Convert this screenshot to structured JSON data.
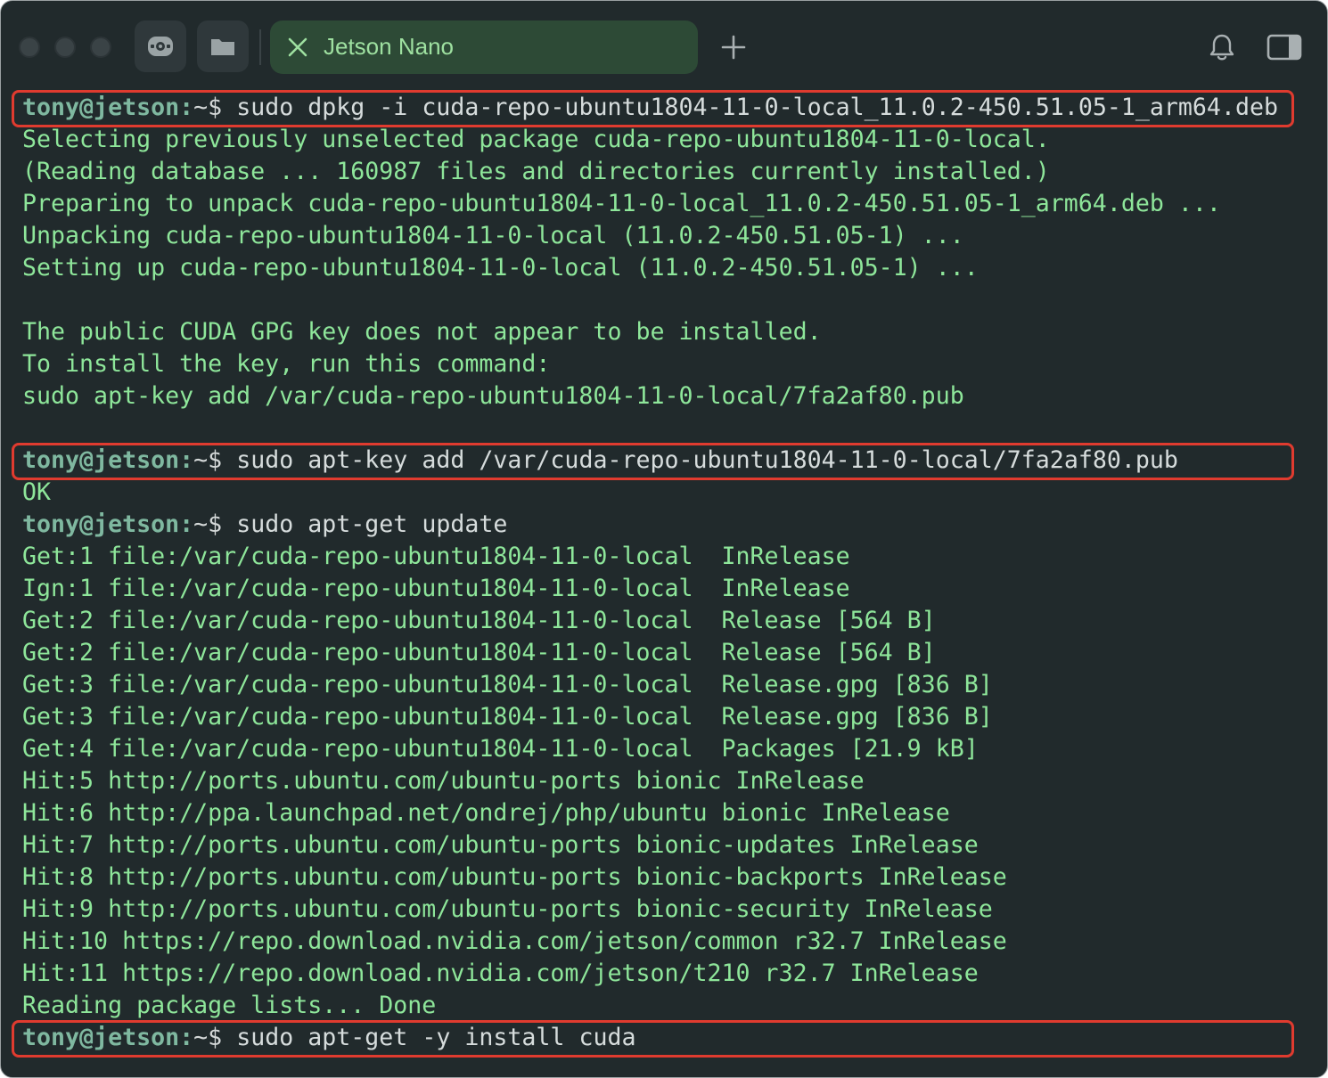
{
  "tab": {
    "title": "Jetson Nano"
  },
  "icons": {
    "tab_close": "close-x-icon",
    "new_tab": "plus-icon",
    "notifications": "bell-icon",
    "sidebar": "sidebar-toggle-icon",
    "tool_1": "steering-wheel-icon",
    "tool_2": "folder-icon"
  },
  "colors": {
    "background": "#212a2c",
    "output_text": "#8ee69a",
    "prompt_user": "#7fb8a0",
    "command_text": "#d6dcdc",
    "highlight_border": "#e03b2f",
    "tab_background": "#2d4a36",
    "tab_text": "#9ee0a0"
  },
  "terminal": {
    "prompt_user": "tony@jetson:",
    "prompt_path": "~$ ",
    "lines": [
      {
        "type": "command",
        "text": "sudo dpkg -i cuda-repo-ubuntu1804-11-0-local_11.0.2-450.51.05-1_arm64.deb",
        "highlighted": true
      },
      {
        "type": "output",
        "text": "Selecting previously unselected package cuda-repo-ubuntu1804-11-0-local."
      },
      {
        "type": "output",
        "text": "(Reading database ... 160987 files and directories currently installed.)"
      },
      {
        "type": "output",
        "text": "Preparing to unpack cuda-repo-ubuntu1804-11-0-local_11.0.2-450.51.05-1_arm64.deb ..."
      },
      {
        "type": "output",
        "text": "Unpacking cuda-repo-ubuntu1804-11-0-local (11.0.2-450.51.05-1) ..."
      },
      {
        "type": "output",
        "text": "Setting up cuda-repo-ubuntu1804-11-0-local (11.0.2-450.51.05-1) ..."
      },
      {
        "type": "output",
        "text": ""
      },
      {
        "type": "output",
        "text": "The public CUDA GPG key does not appear to be installed."
      },
      {
        "type": "output",
        "text": "To install the key, run this command:"
      },
      {
        "type": "output",
        "text": "sudo apt-key add /var/cuda-repo-ubuntu1804-11-0-local/7fa2af80.pub"
      },
      {
        "type": "output",
        "text": ""
      },
      {
        "type": "command",
        "text": "sudo apt-key add /var/cuda-repo-ubuntu1804-11-0-local/7fa2af80.pub",
        "highlighted": true
      },
      {
        "type": "output",
        "text": "OK"
      },
      {
        "type": "command",
        "text": "sudo apt-get update",
        "highlighted": false
      },
      {
        "type": "output",
        "text": "Get:1 file:/var/cuda-repo-ubuntu1804-11-0-local  InRelease"
      },
      {
        "type": "output",
        "text": "Ign:1 file:/var/cuda-repo-ubuntu1804-11-0-local  InRelease"
      },
      {
        "type": "output",
        "text": "Get:2 file:/var/cuda-repo-ubuntu1804-11-0-local  Release [564 B]"
      },
      {
        "type": "output",
        "text": "Get:2 file:/var/cuda-repo-ubuntu1804-11-0-local  Release [564 B]"
      },
      {
        "type": "output",
        "text": "Get:3 file:/var/cuda-repo-ubuntu1804-11-0-local  Release.gpg [836 B]"
      },
      {
        "type": "output",
        "text": "Get:3 file:/var/cuda-repo-ubuntu1804-11-0-local  Release.gpg [836 B]"
      },
      {
        "type": "output",
        "text": "Get:4 file:/var/cuda-repo-ubuntu1804-11-0-local  Packages [21.9 kB]"
      },
      {
        "type": "output",
        "text": "Hit:5 http://ports.ubuntu.com/ubuntu-ports bionic InRelease"
      },
      {
        "type": "output",
        "text": "Hit:6 http://ppa.launchpad.net/ondrej/php/ubuntu bionic InRelease"
      },
      {
        "type": "output",
        "text": "Hit:7 http://ports.ubuntu.com/ubuntu-ports bionic-updates InRelease"
      },
      {
        "type": "output",
        "text": "Hit:8 http://ports.ubuntu.com/ubuntu-ports bionic-backports InRelease"
      },
      {
        "type": "output",
        "text": "Hit:9 http://ports.ubuntu.com/ubuntu-ports bionic-security InRelease"
      },
      {
        "type": "output",
        "text": "Hit:10 https://repo.download.nvidia.com/jetson/common r32.7 InRelease"
      },
      {
        "type": "output",
        "text": "Hit:11 https://repo.download.nvidia.com/jetson/t210 r32.7 InRelease"
      },
      {
        "type": "output",
        "text": "Reading package lists... Done"
      },
      {
        "type": "command",
        "text": "sudo apt-get -y install cuda",
        "highlighted": true
      }
    ]
  }
}
